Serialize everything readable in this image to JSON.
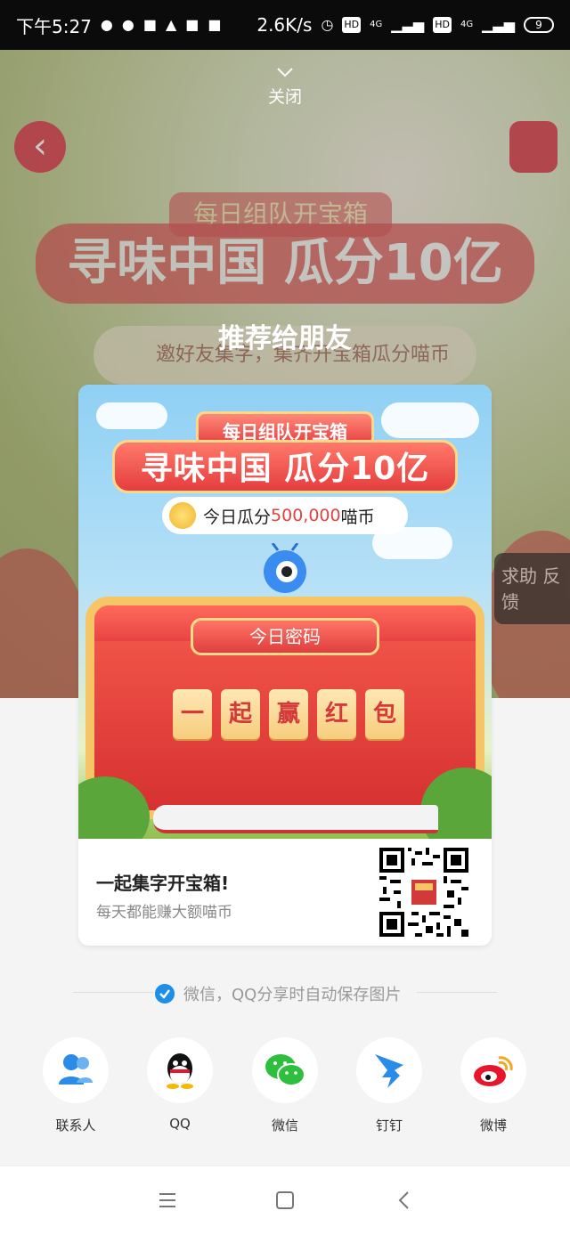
{
  "status_bar": {
    "time": "下午5:27",
    "net_speed": "2.6K/s",
    "hd1": "HD",
    "sig1": "4G",
    "hd2": "HD",
    "sig2": "4G",
    "battery": "9"
  },
  "background": {
    "sub_badge": "每日组队开宝箱",
    "title": "寻味中国 瓜分10亿",
    "pill_text": "邀好友集字，集齐开宝箱瓜分喵币",
    "help_text": "求助 反馈"
  },
  "header": {
    "close_label": "关闭",
    "share_title": "推荐给朋友"
  },
  "poster": {
    "badge": "每日组队开宝箱",
    "banner": "寻味中国 瓜分10亿",
    "coin_prefix": "今日瓜分",
    "coin_amount": "500,000",
    "coin_unit": "喵币",
    "code_label": "今日密码",
    "tiles": [
      "一",
      "起",
      "赢",
      "红",
      "包"
    ]
  },
  "card_footer": {
    "headline": "一起集字开宝箱!",
    "subtitle": "每天都能赚大额喵币"
  },
  "save_option": {
    "text": "微信，QQ分享时自动保存图片",
    "checked": true
  },
  "share_targets": [
    {
      "label": "联系人",
      "icon": "contacts-icon",
      "color": "#2a8be8"
    },
    {
      "label": "QQ",
      "icon": "qq-icon",
      "color": "#111111"
    },
    {
      "label": "微信",
      "icon": "wechat-icon",
      "color": "#2fbf3f"
    },
    {
      "label": "钉钉",
      "icon": "dingtalk-icon",
      "color": "#2a8be8"
    },
    {
      "label": "微博",
      "icon": "weibo-icon",
      "color": "#e6162d"
    }
  ],
  "colors": {
    "accent_blue": "#1e8fe8",
    "poster_red": "#e53d3e",
    "gold": "#f6c666"
  }
}
